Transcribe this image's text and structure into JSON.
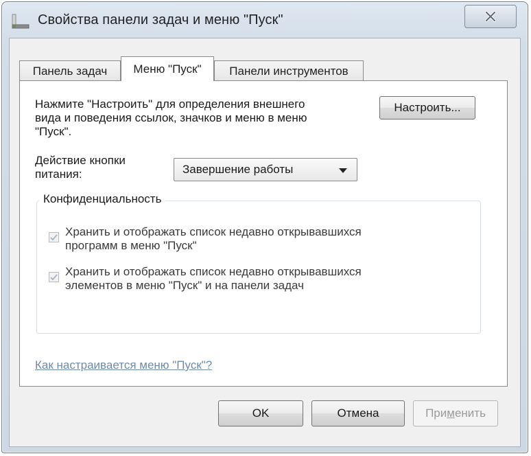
{
  "window": {
    "title": "Свойства панели задач и меню \"Пуск\"",
    "icon": "taskbar-window-icon",
    "close_icon": "close-x-icon"
  },
  "tabs": [
    {
      "label": "Панель задач",
      "active": false
    },
    {
      "label": "Меню \"Пуск\"",
      "active": true
    },
    {
      "label": "Панели инструментов",
      "active": false
    }
  ],
  "start_menu": {
    "description_lines": [
      "Нажмите \"Настроить\" для определения внешнего",
      "вида и поведения ссылок, значков и меню в меню",
      "\"Пуск\"."
    ],
    "customize_button": "Настроить...",
    "power_label_lines": [
      "Действие кнопки",
      "питания:"
    ],
    "power_select_value": "Завершение работы"
  },
  "privacy": {
    "title": "Конфиденциальность",
    "options": [
      {
        "lines": [
          "Хранить и отображать список недавно открывавшихся",
          "программ в меню \"Пуск\""
        ],
        "checked": true,
        "disabled": true
      },
      {
        "lines": [
          "Хранить и отображать список недавно открывавшихся",
          "элементов в меню \"Пуск\" и на панели задач"
        ],
        "checked": true,
        "disabled": true
      }
    ]
  },
  "help_link": "Как настраивается меню \"Пуск\"?",
  "buttons": {
    "ok": "OK",
    "cancel": "Отмена",
    "apply_before": "При",
    "apply_underlined": "м",
    "apply_after": "енить"
  },
  "colors": {
    "link": "#6d8aa8",
    "disabled_text": "#9a9a9a",
    "check_mark": "#a8b8c8"
  }
}
